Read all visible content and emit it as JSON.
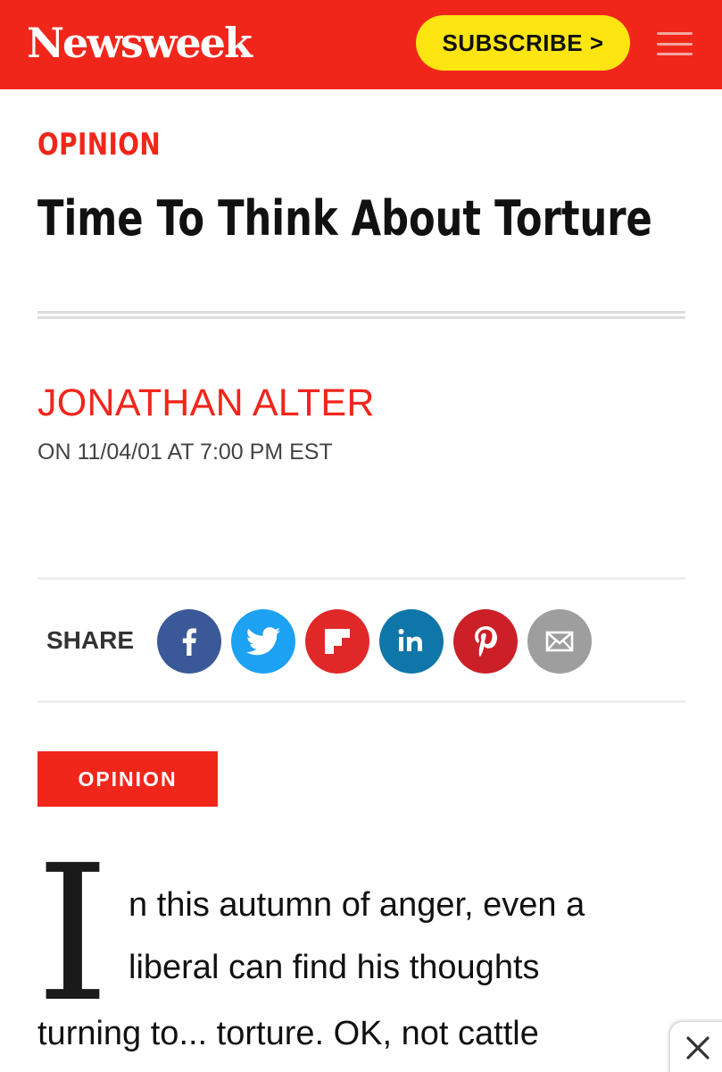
{
  "header": {
    "logo": "Newsweek",
    "subscribe_label": "SUBSCRIBE >",
    "menu_icon": "hamburger-menu-icon",
    "brand_color": "#f1261b",
    "subscribe_color": "#fde512"
  },
  "article": {
    "kicker": "OPINION",
    "title": "Time To Think About Torture",
    "author": "JONATHAN ALTER",
    "dateline": "ON 11/04/01 AT 7:00 PM EST",
    "tag": "OPINION",
    "dropcap": "I",
    "body_lines": [
      "n this autumn of anger, even a",
      "liberal can find his thoughts",
      "turning to... torture. OK, not cattle"
    ]
  },
  "share": {
    "label": "SHARE",
    "buttons": [
      {
        "icon": "facebook-icon",
        "color": "#3b5998"
      },
      {
        "icon": "twitter-icon",
        "color": "#1da1f2"
      },
      {
        "icon": "flipboard-icon",
        "color": "#e12828"
      },
      {
        "icon": "linkedin-icon",
        "color": "#0e76a8"
      },
      {
        "icon": "pinterest-icon",
        "color": "#cb2027"
      },
      {
        "icon": "email-icon",
        "color": "#9e9e9e"
      }
    ]
  },
  "overlay": {
    "close_icon": "close-icon"
  }
}
